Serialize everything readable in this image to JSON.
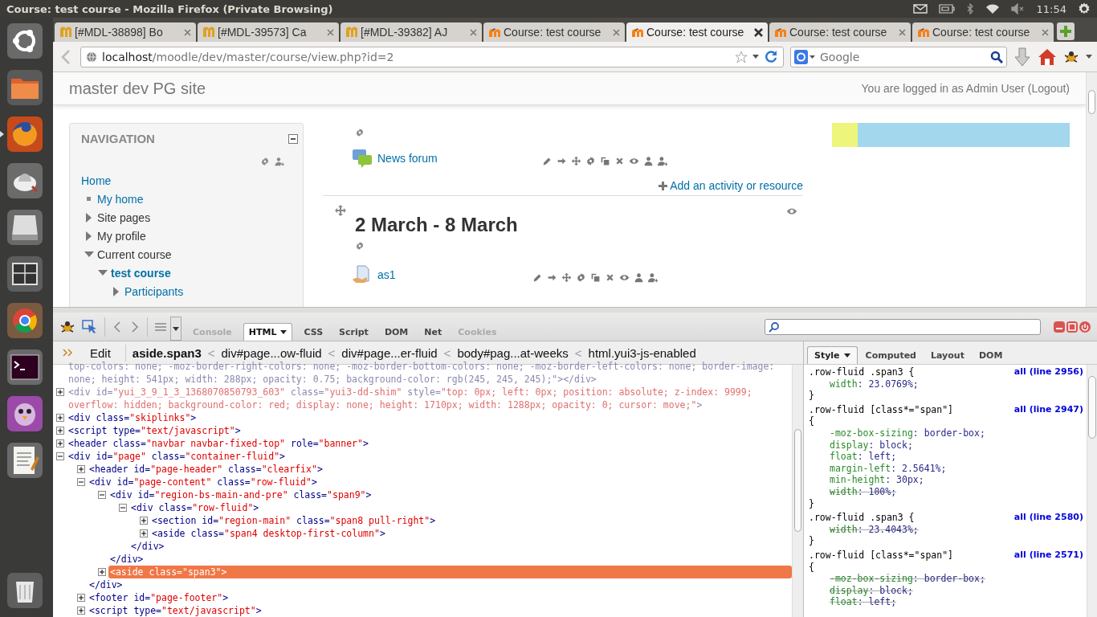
{
  "system_bar": {
    "title": "Course: test course - Mozilla Firefox (Private Browsing)",
    "time": "11:54"
  },
  "launcher": [
    {
      "kind": "home",
      "focused": false
    },
    {
      "kind": "files",
      "focused": false
    },
    {
      "kind": "firefox",
      "focused": true
    },
    {
      "kind": "app",
      "focused": false
    },
    {
      "kind": "disk",
      "focused": false
    },
    {
      "kind": "workspace",
      "focused": false
    },
    {
      "kind": "chrome",
      "focused": false
    },
    {
      "kind": "terminal",
      "focused": false
    },
    {
      "kind": "chat",
      "focused": false
    },
    {
      "kind": "editor",
      "focused": false
    },
    {
      "kind": "trash",
      "focused": false
    }
  ],
  "tabs": [
    {
      "label": "[#MDL-38898] Bo",
      "kind": "jira",
      "selected": false
    },
    {
      "label": "[#MDL-39573] Ca",
      "kind": "jira",
      "selected": false
    },
    {
      "label": "[#MDL-39382] AJ",
      "kind": "jira",
      "selected": false
    },
    {
      "label": "Course: test course",
      "kind": "moodle",
      "selected": false
    },
    {
      "label": "Course: test course",
      "kind": "moodle",
      "selected": true
    },
    {
      "label": "Course: test course",
      "kind": "moodle",
      "selected": false
    },
    {
      "label": "Course: test course",
      "kind": "moodle",
      "selected": false
    }
  ],
  "address": {
    "host": "localhost",
    "path": "/moodle/dev/master/course/view.php?id=2"
  },
  "search": {
    "placeholder": "Google"
  },
  "page": {
    "site_name": "master dev PG site",
    "login": "You are logged in as Admin User (Logout)",
    "navigation": {
      "title": "NAVIGATION",
      "items": [
        {
          "label": "Home",
          "kind": "root",
          "link": true,
          "current": false,
          "children": [
            {
              "label": "My home",
              "kind": "leaf",
              "link": true,
              "current": false
            },
            {
              "label": "Site pages",
              "kind": "branch",
              "link": false,
              "current": false,
              "expanded": false
            },
            {
              "label": "My profile",
              "kind": "branch",
              "link": false,
              "current": false,
              "expanded": false
            },
            {
              "label": "Current course",
              "kind": "branch",
              "link": false,
              "current": false,
              "expanded": true,
              "children": [
                {
                  "label": "test course",
                  "kind": "branch",
                  "link": true,
                  "current": true,
                  "expanded": true,
                  "children": [
                    {
                      "label": "Participants",
                      "kind": "branch",
                      "link": true,
                      "current": false,
                      "expanded": false
                    }
                  ]
                }
              ]
            }
          ]
        }
      ]
    },
    "top_activities": [
      {
        "name": "News forum",
        "kind": "forum"
      }
    ],
    "add_link": "Add an activity or resource",
    "section": {
      "title": "2 March - 8 March",
      "activities": [
        {
          "name": "as1",
          "kind": "assignment"
        }
      ]
    }
  },
  "firebug": {
    "tabs": [
      {
        "label": "Console",
        "selected": false,
        "disabled": true
      },
      {
        "label": "HTML",
        "selected": true,
        "disabled": false
      },
      {
        "label": "CSS",
        "selected": false,
        "disabled": false
      },
      {
        "label": "Script",
        "selected": false,
        "disabled": false
      },
      {
        "label": "DOM",
        "selected": false,
        "disabled": false
      },
      {
        "label": "Net",
        "selected": false,
        "disabled": false
      },
      {
        "label": "Cookies",
        "selected": false,
        "disabled": true
      }
    ],
    "edit": "Edit",
    "breadcrumb": [
      {
        "label": "aside.span3",
        "selected": true
      },
      {
        "separator": "<",
        "label": "div#page...ow-fluid",
        "selected": false
      },
      {
        "separator": "<",
        "label": "div#page...er-fluid",
        "selected": false
      },
      {
        "separator": "<",
        "label": "body#pag...at-weeks",
        "selected": false
      },
      {
        "separator": "<",
        "label": "html.yui3-js-enabled",
        "selected": false
      }
    ],
    "html_tree": [
      {
        "kind": "fragment",
        "text": "top-colors: none; -moz-border-right-colors: none; -moz-border-bottom-colors: none; -moz-border-left-colors: none; border-image: none; height: 541px; width: 288px; opacity: 0.75; background-color: rgb(245, 245, 245);\"></div>",
        "hidden": true,
        "selected": false
      },
      {
        "kind": "element",
        "text": "<div id=\"yui_3_9_1_3_1368070850793_603\" class=\"yui3-dd-shim\" style=\"top: 0px; left: 0px; position: absolute; z-index: 9999; overflow: hidden; background-color: red; display: none; height: 1710px; width: 1288px; opacity: 0; cursor: move;\">",
        "hidden": true,
        "selected": false,
        "expanded": false
      },
      {
        "kind": "element",
        "text": "<div class=\"skiplinks\">",
        "hidden": false,
        "selected": false,
        "expanded": false
      },
      {
        "kind": "element",
        "text": "<script type=\"text/javascript\">",
        "hidden": false,
        "selected": false,
        "expanded": false
      },
      {
        "kind": "element",
        "text": "<header class=\"navbar navbar-fixed-top\" role=\"banner\">",
        "hidden": false,
        "selected": false,
        "expanded": false
      },
      {
        "kind": "element",
        "text": "<div id=\"page\" class=\"container-fluid\">",
        "hidden": false,
        "selected": false,
        "expanded": true,
        "children": [
          {
            "kind": "element",
            "text": "<header id=\"page-header\" class=\"clearfix\">",
            "hidden": false,
            "selected": false,
            "expanded": false
          },
          {
            "kind": "element",
            "text": "<div id=\"page-content\" class=\"row-fluid\">",
            "hidden": false,
            "selected": false,
            "expanded": true,
            "close": "</div>",
            "children": [
              {
                "kind": "element",
                "text": "<div id=\"region-bs-main-and-pre\" class=\"span9\">",
                "hidden": false,
                "selected": false,
                "expanded": true,
                "close": "</div>",
                "children": [
                  {
                    "kind": "element",
                    "text": "<div class=\"row-fluid\">",
                    "hidden": false,
                    "selected": false,
                    "expanded": true,
                    "close": "</div>",
                    "children": [
                      {
                        "kind": "element",
                        "text": "<section id=\"region-main\" class=\"span8 pull-right\">",
                        "hidden": false,
                        "selected": false,
                        "expanded": false
                      },
                      {
                        "kind": "element",
                        "text": "<aside class=\"span4 desktop-first-column\">",
                        "hidden": false,
                        "selected": false,
                        "expanded": false
                      }
                    ]
                  }
                ]
              },
              {
                "kind": "element",
                "text": "<aside class=\"span3\">",
                "hidden": false,
                "selected": true,
                "expanded": false
              }
            ]
          },
          {
            "kind": "element",
            "text": "<footer id=\"page-footer\">",
            "hidden": false,
            "selected": false,
            "expanded": false
          },
          {
            "kind": "element",
            "text": "<script type=\"text/javascript\">",
            "hidden": false,
            "selected": false,
            "expanded": false
          }
        ]
      }
    ],
    "side_tabs": [
      {
        "label": "Style",
        "selected": true
      },
      {
        "label": "Computed",
        "selected": false
      },
      {
        "label": "Layout",
        "selected": false
      },
      {
        "label": "DOM",
        "selected": false
      }
    ],
    "rules": [
      {
        "selector": ".row-fluid .span3 {",
        "source": "all (line 2956)",
        "props": [
          {
            "text": "width: 23.0769%;",
            "overridden": false
          }
        ],
        "close": "}"
      },
      {
        "selector": ".row-fluid [class*=\"span\"]",
        "brace": "{",
        "source": "all (line 2947)",
        "props": [
          {
            "text": "-moz-box-sizing: border-box;",
            "overridden": false
          },
          {
            "text": "display: block;",
            "overridden": false
          },
          {
            "text": "float: left;",
            "overridden": false
          },
          {
            "text": "margin-left: 2.5641%;",
            "overridden": false
          },
          {
            "text": "min-height: 30px;",
            "overridden": false
          },
          {
            "text": "width: 100%;",
            "overridden": true
          }
        ],
        "close": "}"
      },
      {
        "selector": ".row-fluid .span3 {",
        "source": "all (line 2580)",
        "props": [
          {
            "text": "width: 23.4043%;",
            "overridden": true
          }
        ],
        "close": "}"
      },
      {
        "selector": ".row-fluid [class*=\"span\"]",
        "brace": "{",
        "source": "all (line 2571)",
        "props": [
          {
            "text": "-moz-box-sizing: border-box;",
            "overridden": true
          },
          {
            "text": "display: block;",
            "overridden": true
          },
          {
            "text": "float: left;",
            "overridden": true
          }
        ]
      }
    ]
  }
}
